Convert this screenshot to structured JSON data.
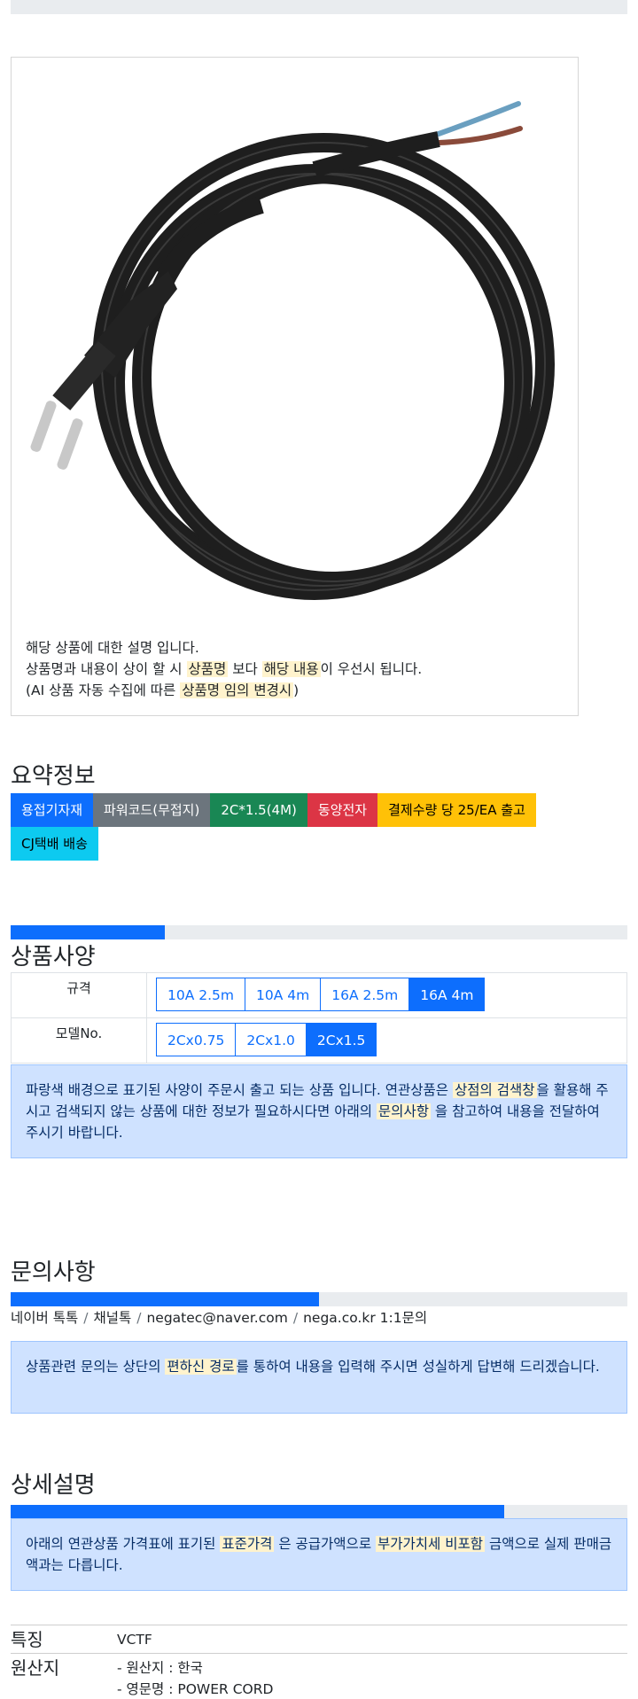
{
  "product_description": {
    "line1": "해당 상품에 대한 설명 입니다.",
    "line2_a": "상품명과 내용이 상이 할 시 ",
    "line2_hl1": "상품명",
    "line2_b": " 보다 ",
    "line2_hl2": "해당 내용",
    "line2_c": "이 우선시 됩니다.",
    "line3_a": "(AI 상품 자동 수집에 따른 ",
    "line3_hl": "상품명 임의 변경시",
    "line3_b": ")"
  },
  "summary": {
    "title": "요약정보",
    "badges": [
      {
        "label": "용접기자재",
        "variant": "primary"
      },
      {
        "label": "파워코드(무접지)",
        "variant": "secondary"
      },
      {
        "label": "2C*1.5(4M)",
        "variant": "success"
      },
      {
        "label": "동양전자",
        "variant": "danger"
      },
      {
        "label": "결제수량 당 25/EA 출고",
        "variant": "warning"
      },
      {
        "label": "CJ택배 배송",
        "variant": "info"
      }
    ]
  },
  "spec": {
    "progress_fraction": 0.25,
    "title": "상품사양",
    "rows": [
      {
        "label": "규격",
        "options": [
          "10A 2.5m",
          "10A 4m",
          "16A 2.5m",
          "16A 4m"
        ],
        "active": 3
      },
      {
        "label": "모델No.",
        "options": [
          "2Cx0.75",
          "2Cx1.0",
          "2Cx1.5"
        ],
        "active": 2
      }
    ],
    "notice_a": "파랑색 배경으로 표기된 사양이 주문시 출고 되는 상품 입니다. 연관상품은 ",
    "notice_hl1": "상점의 검색창",
    "notice_b": "을 활용해 주시고 검색되지 않는 상품에 대한 정보가 필요하시다면 아래의 ",
    "notice_hl2": "문의사항",
    "notice_c": " 을 참고하여 내용을 전달하여 주시기 바랍니다."
  },
  "inquiry": {
    "title": "문의사항",
    "progress_fraction": 0.5,
    "links": [
      "네이버 톡톡",
      "채널톡",
      "negatec@naver.com",
      "nega.co.kr 1:1문의"
    ],
    "separator": "/",
    "notice_a": "상품관련 문의는 상단의 ",
    "notice_hl": "편하신 경로",
    "notice_b": "를 통하여 내용을 입력해 주시면 성실하게 답변해 드리겠습니다."
  },
  "detail": {
    "title": "상세설명",
    "progress_fraction": 0.8,
    "notice_a": "아래의 연관상품 가격표에 표기된 ",
    "notice_hl1": "표준가격",
    "notice_b": " 은 공급가액으로 ",
    "notice_hl2": "부가가치세 비포함",
    "notice_c": " 금액으로 실제 판매금액과는 다릅니다.",
    "rows": [
      {
        "key": "특징",
        "values": [
          "VCTF"
        ]
      },
      {
        "key": "원산지",
        "values": [
          "- 원산지 : 한국",
          "- 영문명 : POWER CORD"
        ]
      }
    ]
  },
  "colors": {
    "primary": "#0d6efd",
    "secondary": "#6c757d",
    "success": "#198754",
    "danger": "#dc3545",
    "warning": "#ffc107",
    "info": "#0dcaf0",
    "alert_bg": "#cfe2ff",
    "highlight": "#fff3cd"
  }
}
